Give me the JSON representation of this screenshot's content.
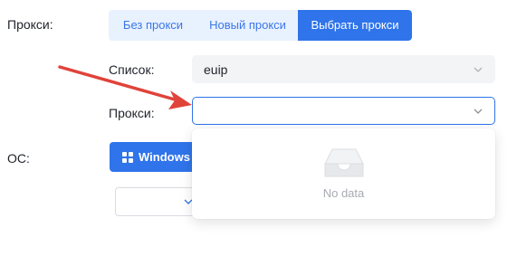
{
  "proxy": {
    "label": "Прокси:",
    "tabs": [
      {
        "label": "Без прокси",
        "active": false
      },
      {
        "label": "Новый прокси",
        "active": false
      },
      {
        "label": "Выбрать прокси",
        "active": true
      }
    ]
  },
  "list": {
    "label": "Список:",
    "value": "euip"
  },
  "proxy_select": {
    "label": "Прокси:",
    "value": ""
  },
  "dropdown": {
    "empty_text": "No data"
  },
  "os": {
    "label": "ОС:",
    "button_label": "Windows"
  },
  "colors": {
    "accent": "#2f74ea",
    "arrow": "#e0433a",
    "segment_bg": "#e8f1fe"
  }
}
